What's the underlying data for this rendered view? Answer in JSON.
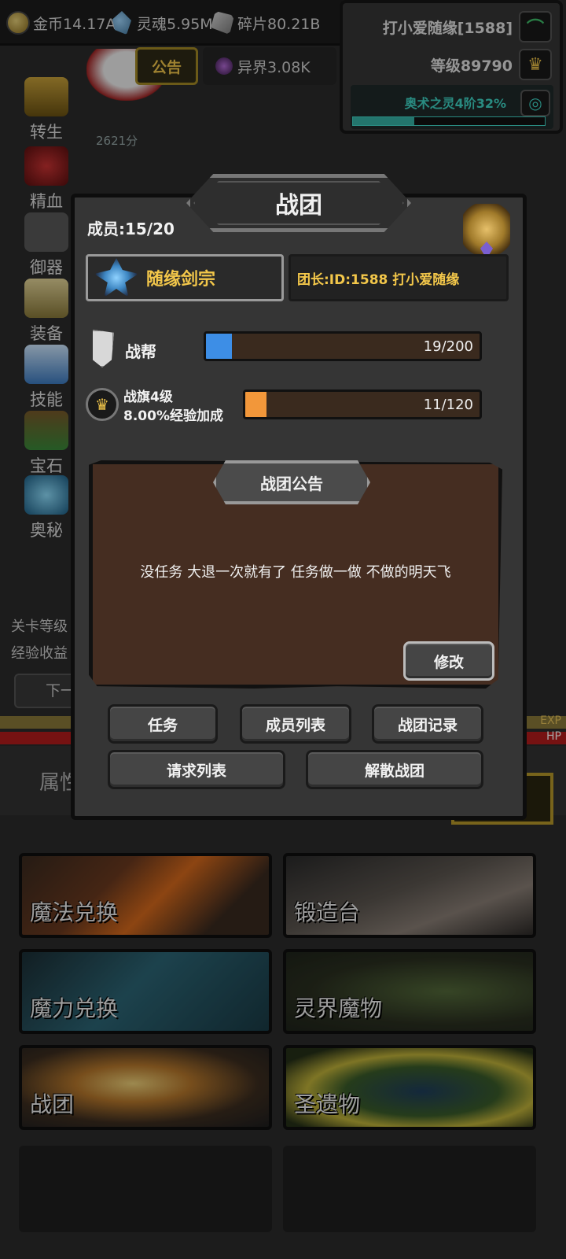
{
  "resources": {
    "gold": "金币14.17A",
    "soul": "灵魂5.95M",
    "fragment": "碎片80.21B",
    "other_world": "异界3.08K"
  },
  "player": {
    "name": "打小爱随缘[1588]",
    "level": "等级89790",
    "arcane_label": "奥术之灵4阶32%",
    "arcane_progress": 0.32
  },
  "background": {
    "notice_tab": "公告",
    "score": "2621分",
    "left_nav": [
      "转生",
      "精血",
      "御器",
      "装备",
      "技能",
      "宝石",
      "奥秘"
    ],
    "stage_label": "关卡等级",
    "exp_label": "经验收益",
    "next_label": "下一",
    "exp_bar": "EXP",
    "hp_bar": "HP",
    "attr_label": "属性"
  },
  "menu": {
    "tiles": [
      {
        "label": "魔法兑换"
      },
      {
        "label": "锻造台"
      },
      {
        "label": "魔力兑换"
      },
      {
        "label": "灵界魔物"
      },
      {
        "label": "战团"
      },
      {
        "label": "圣遗物"
      }
    ]
  },
  "dialog": {
    "title": "战团",
    "members": "成员:15/20",
    "guild_name": "随缘剑宗",
    "leader": "团长:ID:1588 打小爱随缘",
    "stat1": {
      "label": "战帮",
      "value_text": "19/200",
      "current": 19,
      "max": 200,
      "color": "#3d8ee6"
    },
    "stat2": {
      "label_line1": "战旗4级",
      "label_line2": "8.00%经验加成",
      "value_text": "11/120",
      "current": 11,
      "max": 120,
      "color": "#f2973a"
    },
    "board_title": "战团公告",
    "board_text": "没任务 大退一次就有了 任务做一做 不做的明天飞",
    "edit_button": "修改",
    "buttons": {
      "tasks": "任务",
      "member_list": "成员列表",
      "records": "战团记录",
      "requests": "请求列表",
      "disband": "解散战团"
    }
  }
}
